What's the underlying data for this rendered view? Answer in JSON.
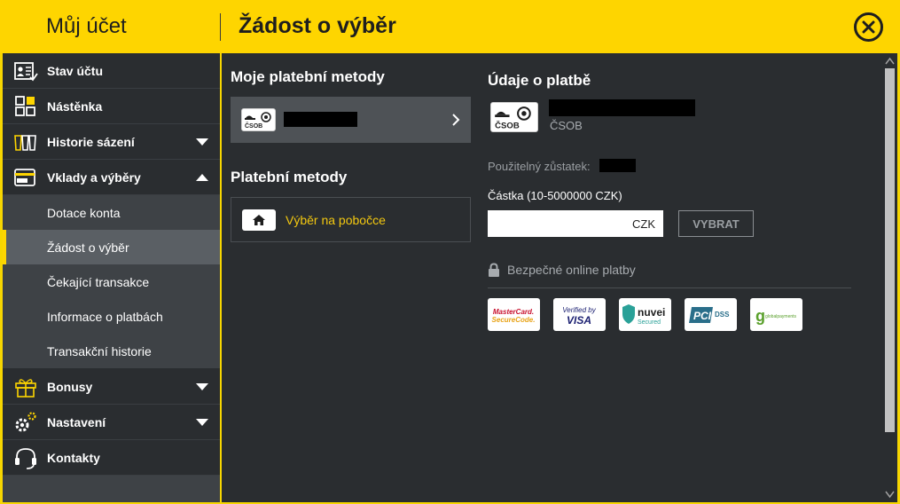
{
  "header": {
    "left_title": "Můj účet",
    "title": "Žádost o výběr"
  },
  "sidebar": {
    "items": [
      {
        "label": "Stav účtu",
        "icon": "account-status-icon"
      },
      {
        "label": "Nástěnka",
        "icon": "dashboard-icon"
      },
      {
        "label": "Historie sázení",
        "icon": "betting-history-icon"
      },
      {
        "label": "Vklady a výběry",
        "icon": "wallet-icon"
      },
      {
        "label": "Bonusy",
        "icon": "gift-icon"
      },
      {
        "label": "Nastavení",
        "icon": "gear-icon"
      },
      {
        "label": "Kontakty",
        "icon": "headset-icon"
      }
    ],
    "subitems": [
      {
        "label": "Dotace konta",
        "active": false
      },
      {
        "label": "Žádost o výběr",
        "active": true
      },
      {
        "label": "Čekající transakce",
        "active": false
      },
      {
        "label": "Informace o platbách",
        "active": false
      },
      {
        "label": "Transakční historie",
        "active": false
      }
    ]
  },
  "main": {
    "my_methods_title": "Moje platební metody",
    "payment_methods_title": "Platební metody",
    "branch_withdrawal": "Výběr na pobočce",
    "details_title": "Údaje o platbě",
    "bank_name": "ČSOB",
    "bank_logo_text": "ČSOB",
    "balance_label": "Použitelný zůstatek:",
    "amount_label": "Částka (10-5000000 CZK)",
    "amount_value": "",
    "currency": "CZK",
    "withdraw_button": "VYBRAT",
    "secure_label": "Bezpečné online platby",
    "badges": [
      {
        "name": "mastercard-securecode-badge",
        "line1": "MasterCard.",
        "line2": "SecureCode."
      },
      {
        "name": "verified-by-visa-badge",
        "line1": "Verified by",
        "line2": "VISA"
      },
      {
        "name": "nuvei-secured-badge",
        "line1": "nuvei",
        "line2": "Secured"
      },
      {
        "name": "pci-dss-badge",
        "line1": "PCI",
        "line2": "DSS"
      },
      {
        "name": "globalpayments-badge",
        "line1": "g",
        "line2": "globalpayments"
      }
    ]
  },
  "colors": {
    "accent": "#fed500",
    "panel": "#2a2d30",
    "link": "#f3c810"
  }
}
